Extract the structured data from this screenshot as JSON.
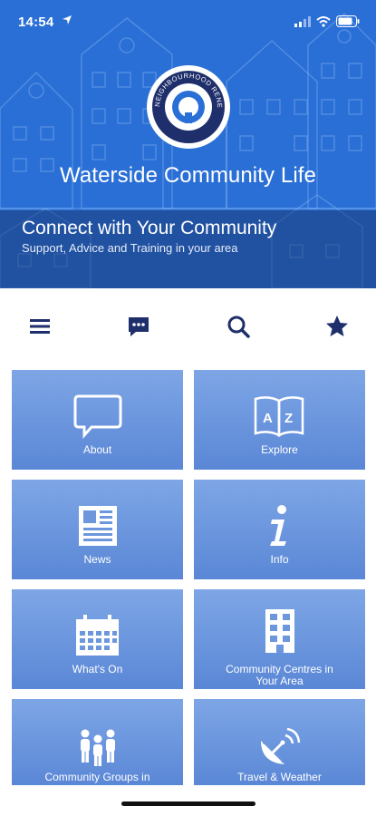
{
  "status": {
    "time": "14:54"
  },
  "hero": {
    "logo_text": "NEIGHBOURHOOD RENEWAL",
    "app_title": "Waterside Community Life",
    "banner_title": "Connect with Your Community",
    "banner_subtitle": "Support, Advice and Training in your area"
  },
  "toolbar": {
    "icons": [
      "menu-icon",
      "chat-icon",
      "search-icon",
      "star-icon"
    ],
    "color": "#1f2f6b"
  },
  "tiles": [
    {
      "label": "About",
      "icon": "speech-bubble-icon"
    },
    {
      "label": "Explore",
      "icon": "az-book-icon"
    },
    {
      "label": "News",
      "icon": "newspaper-icon"
    },
    {
      "label": "Info",
      "icon": "info-icon"
    },
    {
      "label": "What's On",
      "icon": "calendar-icon"
    },
    {
      "label": "Community Centres in Your Area",
      "icon": "building-icon"
    },
    {
      "label": "Community Groups in",
      "icon": "people-icon"
    },
    {
      "label": "Travel & Weather",
      "icon": "satellite-dish-icon"
    }
  ],
  "colors": {
    "hero_blue": "#2a6fd6",
    "tile_blue": "#6d97dd",
    "nav_navy": "#1f2f6b"
  }
}
